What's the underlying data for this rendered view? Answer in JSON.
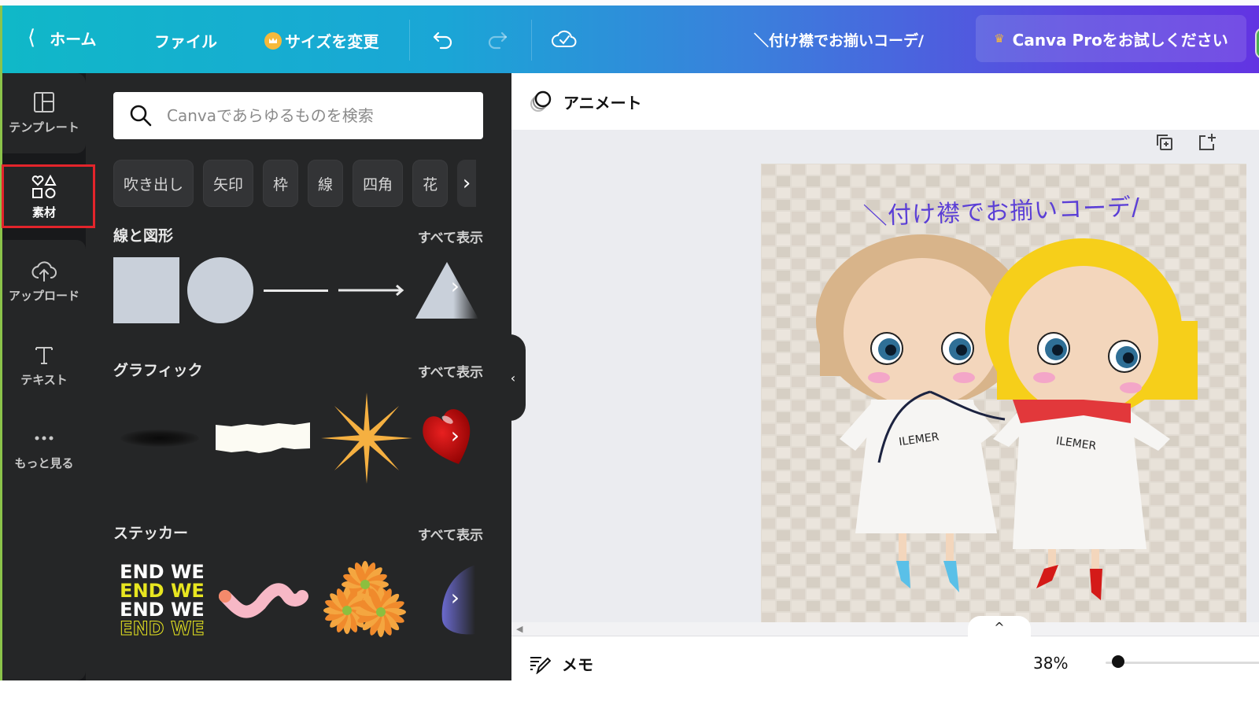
{
  "header": {
    "home_label": "ホーム",
    "file_label": "ファイル",
    "resize_label": "サイズを変更",
    "doc_title": "＼付け襟でお揃いコーデ/",
    "pro_label": "Canva Proをお試しください",
    "colors": {
      "gradient_start": "#10b8c8",
      "gradient_end": "#6234e2",
      "crown": "#f6b93b"
    }
  },
  "rail": {
    "items": [
      {
        "label": "テンプレート",
        "icon": "template-icon",
        "active": false
      },
      {
        "label": "素材",
        "icon": "elements-icon",
        "active": true
      },
      {
        "label": "アップロード",
        "icon": "upload-cloud-icon",
        "active": false
      },
      {
        "label": "テキスト",
        "icon": "text-icon",
        "active": false
      },
      {
        "label": "もっと見る",
        "icon": "more-dots-icon",
        "active": false
      }
    ],
    "highlight_color": "#e3242b"
  },
  "panel": {
    "search_placeholder": "Canvaであらゆるものを検索",
    "chips": [
      "吹き出し",
      "矢印",
      "枠",
      "線",
      "四角",
      "花"
    ],
    "sections": [
      {
        "title": "線と図形",
        "see_all": "すべて表示",
        "items": [
          "square",
          "circle",
          "line",
          "arrow",
          "triangle"
        ]
      },
      {
        "title": "グラフィック",
        "see_all": "すべて表示",
        "items": [
          "shadow-ellipse",
          "torn-paper",
          "starburst",
          "red-heart"
        ]
      },
      {
        "title": "ステッカー",
        "see_all": "すべて表示",
        "items": [
          "weekend-text-sticker",
          "pink-worm",
          "orange-flowers",
          "purple-shape"
        ]
      }
    ],
    "sticker_text": {
      "end": "END",
      "we": "WE"
    }
  },
  "editor": {
    "animate_label": "アニメート",
    "canvas_text": "＼付け襟でお揃いコーデ/",
    "canvas_doll_label": "ILEMER",
    "memo_label": "メモ",
    "zoom_label": "38%",
    "zoom_percent": 38,
    "zoom_slider_fraction": 0.08
  }
}
